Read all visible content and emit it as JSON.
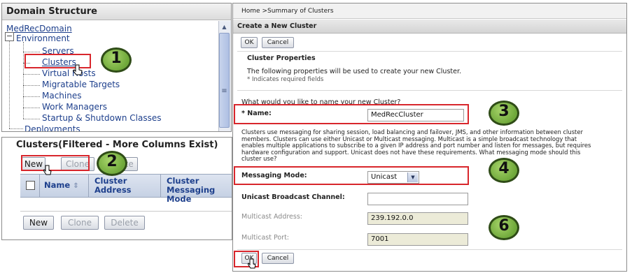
{
  "domain_structure": {
    "title": "Domain Structure",
    "root": "MedRecDomain",
    "environment": "Environment",
    "env_children": [
      "Servers",
      "Clusters",
      "Virtual Hosts",
      "Migratable Targets",
      "Machines",
      "Work Managers",
      "Startup & Shutdown Classes"
    ],
    "deployments": "Deployments"
  },
  "clusters_table": {
    "title": "Clusters(Filtered - More Columns Exist)",
    "top_buttons": {
      "new": "New",
      "clone": "Clone",
      "delete": "Delete"
    },
    "columns": [
      "Name",
      "Cluster Address",
      "Cluster Messaging Mode"
    ],
    "bottom_buttons": {
      "new": "New",
      "clone": "Clone",
      "delete": "Delete"
    }
  },
  "create_cluster": {
    "breadcrumb": "Home >Summary of Clusters",
    "header": "Create a New Cluster",
    "ok_label": "OK",
    "cancel_label": "Cancel",
    "section_title": "Cluster Properties",
    "intro": "The following properties will be used to create your new Cluster.",
    "required_note": "* Indicates required fields",
    "question": "What would you like to name your new Cluster?",
    "name_label": "* Name:",
    "name_value": "MedRecCluster",
    "messaging_desc": [
      "Clusters use messaging for sharing session, load balancing and failover, JMS, and other information between cluster",
      "members. Clusters can use either Unicast or Multicast messaging. Multicast is a simple broadcast technology that",
      "enables multiple applications to subscribe to a given IP address and port number and listen for messages, but requires",
      "hardware configuration and support. Unicast does not have these requirements. What messaging mode should this",
      "cluster use?"
    ],
    "messaging_label": "Messaging Mode:",
    "messaging_value": "Unicast",
    "unicast_label": "Unicast Broadcast Channel:",
    "unicast_value": "",
    "multicast_address_label": "Multicast Address:",
    "multicast_address_value": "239.192.0.0",
    "multicast_port_label": "Multicast Port:",
    "multicast_port_value": "7001"
  },
  "annotations": [
    "1",
    "2",
    "3",
    "4",
    "6"
  ],
  "colors": {
    "link": "#1d3f8c",
    "highlight": "#d8262c",
    "badge": "#7fb848"
  }
}
